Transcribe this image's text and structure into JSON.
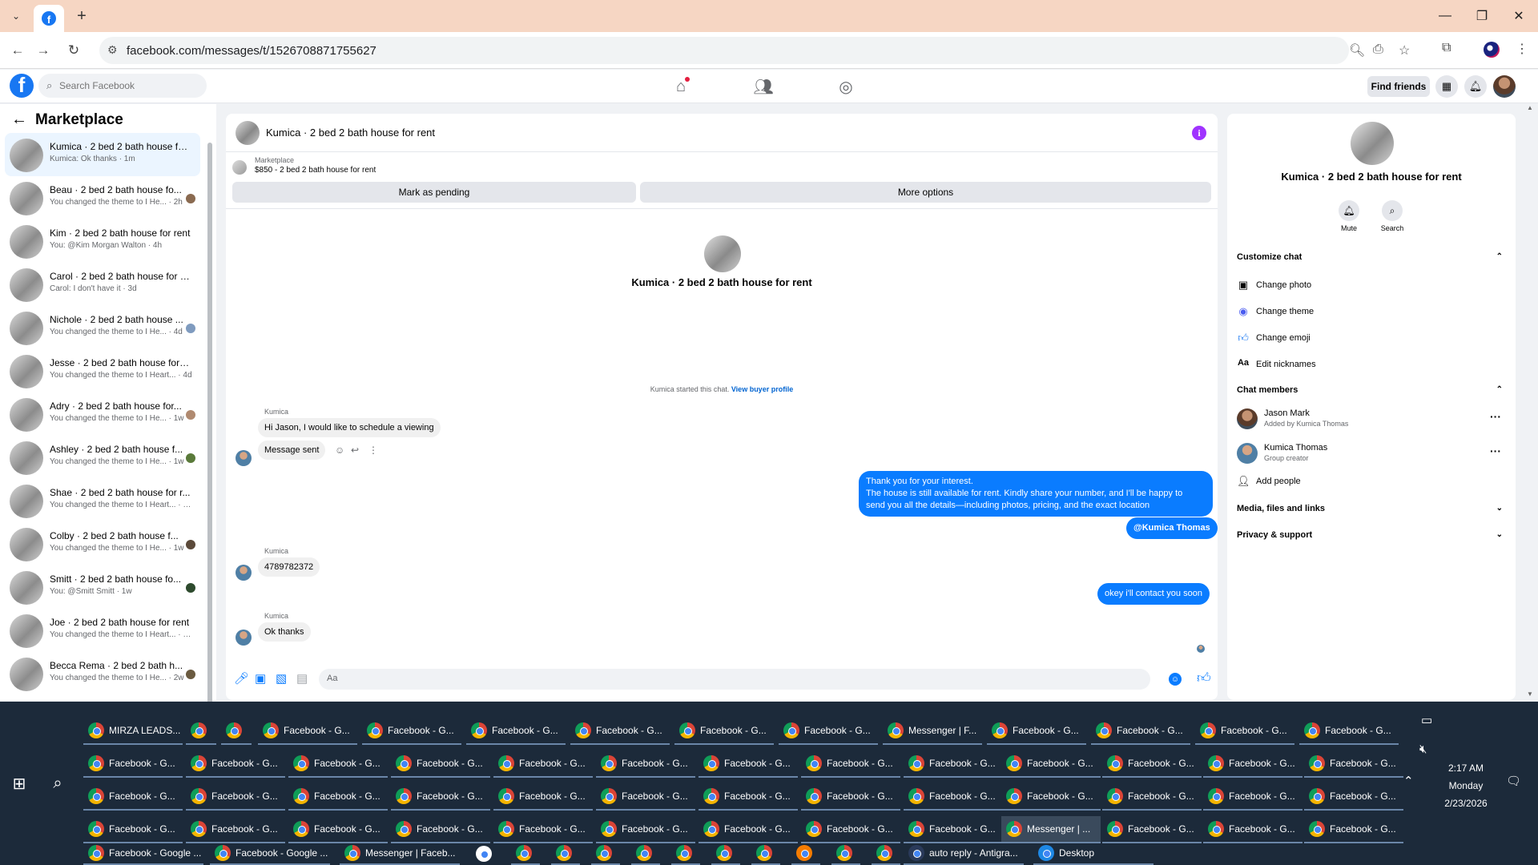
{
  "browser": {
    "url": "facebook.com/messages/t/1526708871755627",
    "tab_icon": "facebook-icon"
  },
  "fb_header": {
    "search_placeholder": "Search Facebook",
    "find_friends": "Find friends"
  },
  "sidebar": {
    "title": "Marketplace",
    "conversations": [
      {
        "title": "Kumica · 2 bed 2 bath house fo...",
        "snippet": "Kumica: Ok thanks · 1m",
        "active": true
      },
      {
        "title": "Beau · 2 bed 2 bath house fo...",
        "snippet": "You changed the theme to I He... · 2h"
      },
      {
        "title": "Kim · 2 bed 2 bath house for rent",
        "snippet": "You: @Kim Morgan Walton · 4h"
      },
      {
        "title": "Carol · 2 bed 2 bath house for r...",
        "snippet": "Carol: I don't have it · 3d"
      },
      {
        "title": "Nichole · 2 bed 2 bath house ...",
        "snippet": "You changed the theme to I He... · 4d"
      },
      {
        "title": "Jesse · 2 bed 2 bath house for r...",
        "snippet": "You changed the theme to I Heart... · 4d"
      },
      {
        "title": "Adry · 2 bed 2 bath house for...",
        "snippet": "You changed the theme to I He... · 1w"
      },
      {
        "title": "Ashley · 2 bed 2 bath house f...",
        "snippet": "You changed the theme to I He... · 1w"
      },
      {
        "title": "Shae · 2 bed 2 bath house for r...",
        "snippet": "You changed the theme to I Heart... · 1w"
      },
      {
        "title": "Colby · 2 bed 2 bath house f...",
        "snippet": "You changed the theme to I He... · 1w"
      },
      {
        "title": "Smitt · 2 bed 2 bath house fo...",
        "snippet": "You: @Smitt Smitt · 1w"
      },
      {
        "title": "Joe · 2 bed 2 bath house for rent",
        "snippet": "You changed the theme to I Heart... · 2w"
      },
      {
        "title": "Becca Rema · 2 bed 2 bath h...",
        "snippet": "You changed the theme to I He... · 2w"
      }
    ]
  },
  "chat": {
    "title": "Kumica · 2 bed 2 bath house for rent",
    "marketplace_label": "Marketplace",
    "listing": "$850 - 2 bed 2 bath house for rent",
    "mark_pending": "Mark as pending",
    "more_options": "More options",
    "intro_name": "Kumica · 2 bed 2 bath house for rent",
    "started_text": "Kumica started this chat.",
    "view_buyer": "View buyer profile",
    "sender": "Kumica",
    "msg1": "Hi Jason, I would like to schedule a viewing",
    "msg2": "Message sent",
    "out1_line1": "Thank you for your interest.",
    "out1_line2": "The house is still available for rent. Kindly share your number, and I'll be happy to",
    "out1_line3": "send you all the details—including photos, pricing, and the exact location",
    "out_mention": "@Kumica Thomas",
    "msg3": "4789782372",
    "out2": "okey i'll contact you soon",
    "msg4": "Ok thanks",
    "composer_placeholder": "Aa"
  },
  "right_panel": {
    "name": "Kumica · 2 bed 2 bath house for rent",
    "mute": "Mute",
    "search": "Search",
    "customize": "Customize chat",
    "change_photo": "Change photo",
    "change_theme": "Change theme",
    "change_emoji": "Change emoji",
    "edit_nicknames": "Edit nicknames",
    "chat_members": "Chat members",
    "member1_name": "Jason Mark",
    "member1_sub": "Added by Kumica Thomas",
    "member2_name": "Kumica Thomas",
    "member2_sub": "Group creator",
    "add_people": "Add people",
    "media": "Media, files and links",
    "privacy": "Privacy & support"
  },
  "taskbar": {
    "rows": [
      [
        "MIRZA LEADS...",
        "",
        "",
        "Facebook - G...",
        "Facebook - G...",
        "Facebook - G...",
        "Facebook - G...",
        "Facebook - G...",
        "Facebook - G...",
        "Messenger | F...",
        "Facebook - G...",
        "Facebook - G...",
        "Facebook - G...",
        "Facebook - G..."
      ],
      [
        "Facebook - G...",
        "Facebook - G...",
        "Facebook - G...",
        "Facebook - G...",
        "Facebook - G...",
        "Facebook - G...",
        "Facebook - G...",
        "Facebook - G...",
        "Facebook - G...",
        "Facebook - G...",
        "Facebook - G...",
        "Facebook - G...",
        "Facebook - G..."
      ],
      [
        "Facebook - G...",
        "Facebook - G...",
        "Facebook - G...",
        "Facebook - G...",
        "Facebook - G...",
        "Facebook - G...",
        "Facebook - G...",
        "Facebook - G...",
        "Facebook - G...",
        "Facebook - G...",
        "Facebook - G...",
        "Facebook - G...",
        "Facebook - G..."
      ],
      [
        "Facebook - G...",
        "Facebook - G...",
        "Facebook - G...",
        "Facebook - G...",
        "Facebook - G...",
        "Facebook - G...",
        "Facebook - G...",
        "Facebook - G...",
        "Facebook - G...",
        "Messenger | ...",
        "Facebook - G...",
        "Facebook - G...",
        "Facebook - G..."
      ]
    ],
    "bottom": [
      "Facebook - Google ...",
      "Facebook - Google ...",
      "Messenger | Faceb...",
      "auto reply - Antigra...",
      "Desktop"
    ],
    "time": "2:17 AM",
    "day": "Monday",
    "date": "2/23/2026"
  },
  "colors": {
    "accent": "#0a7cff",
    "facebook_blue": "#1877f2",
    "tabstrip": "#f6d6c3",
    "taskbar": "#1c2a3a"
  }
}
